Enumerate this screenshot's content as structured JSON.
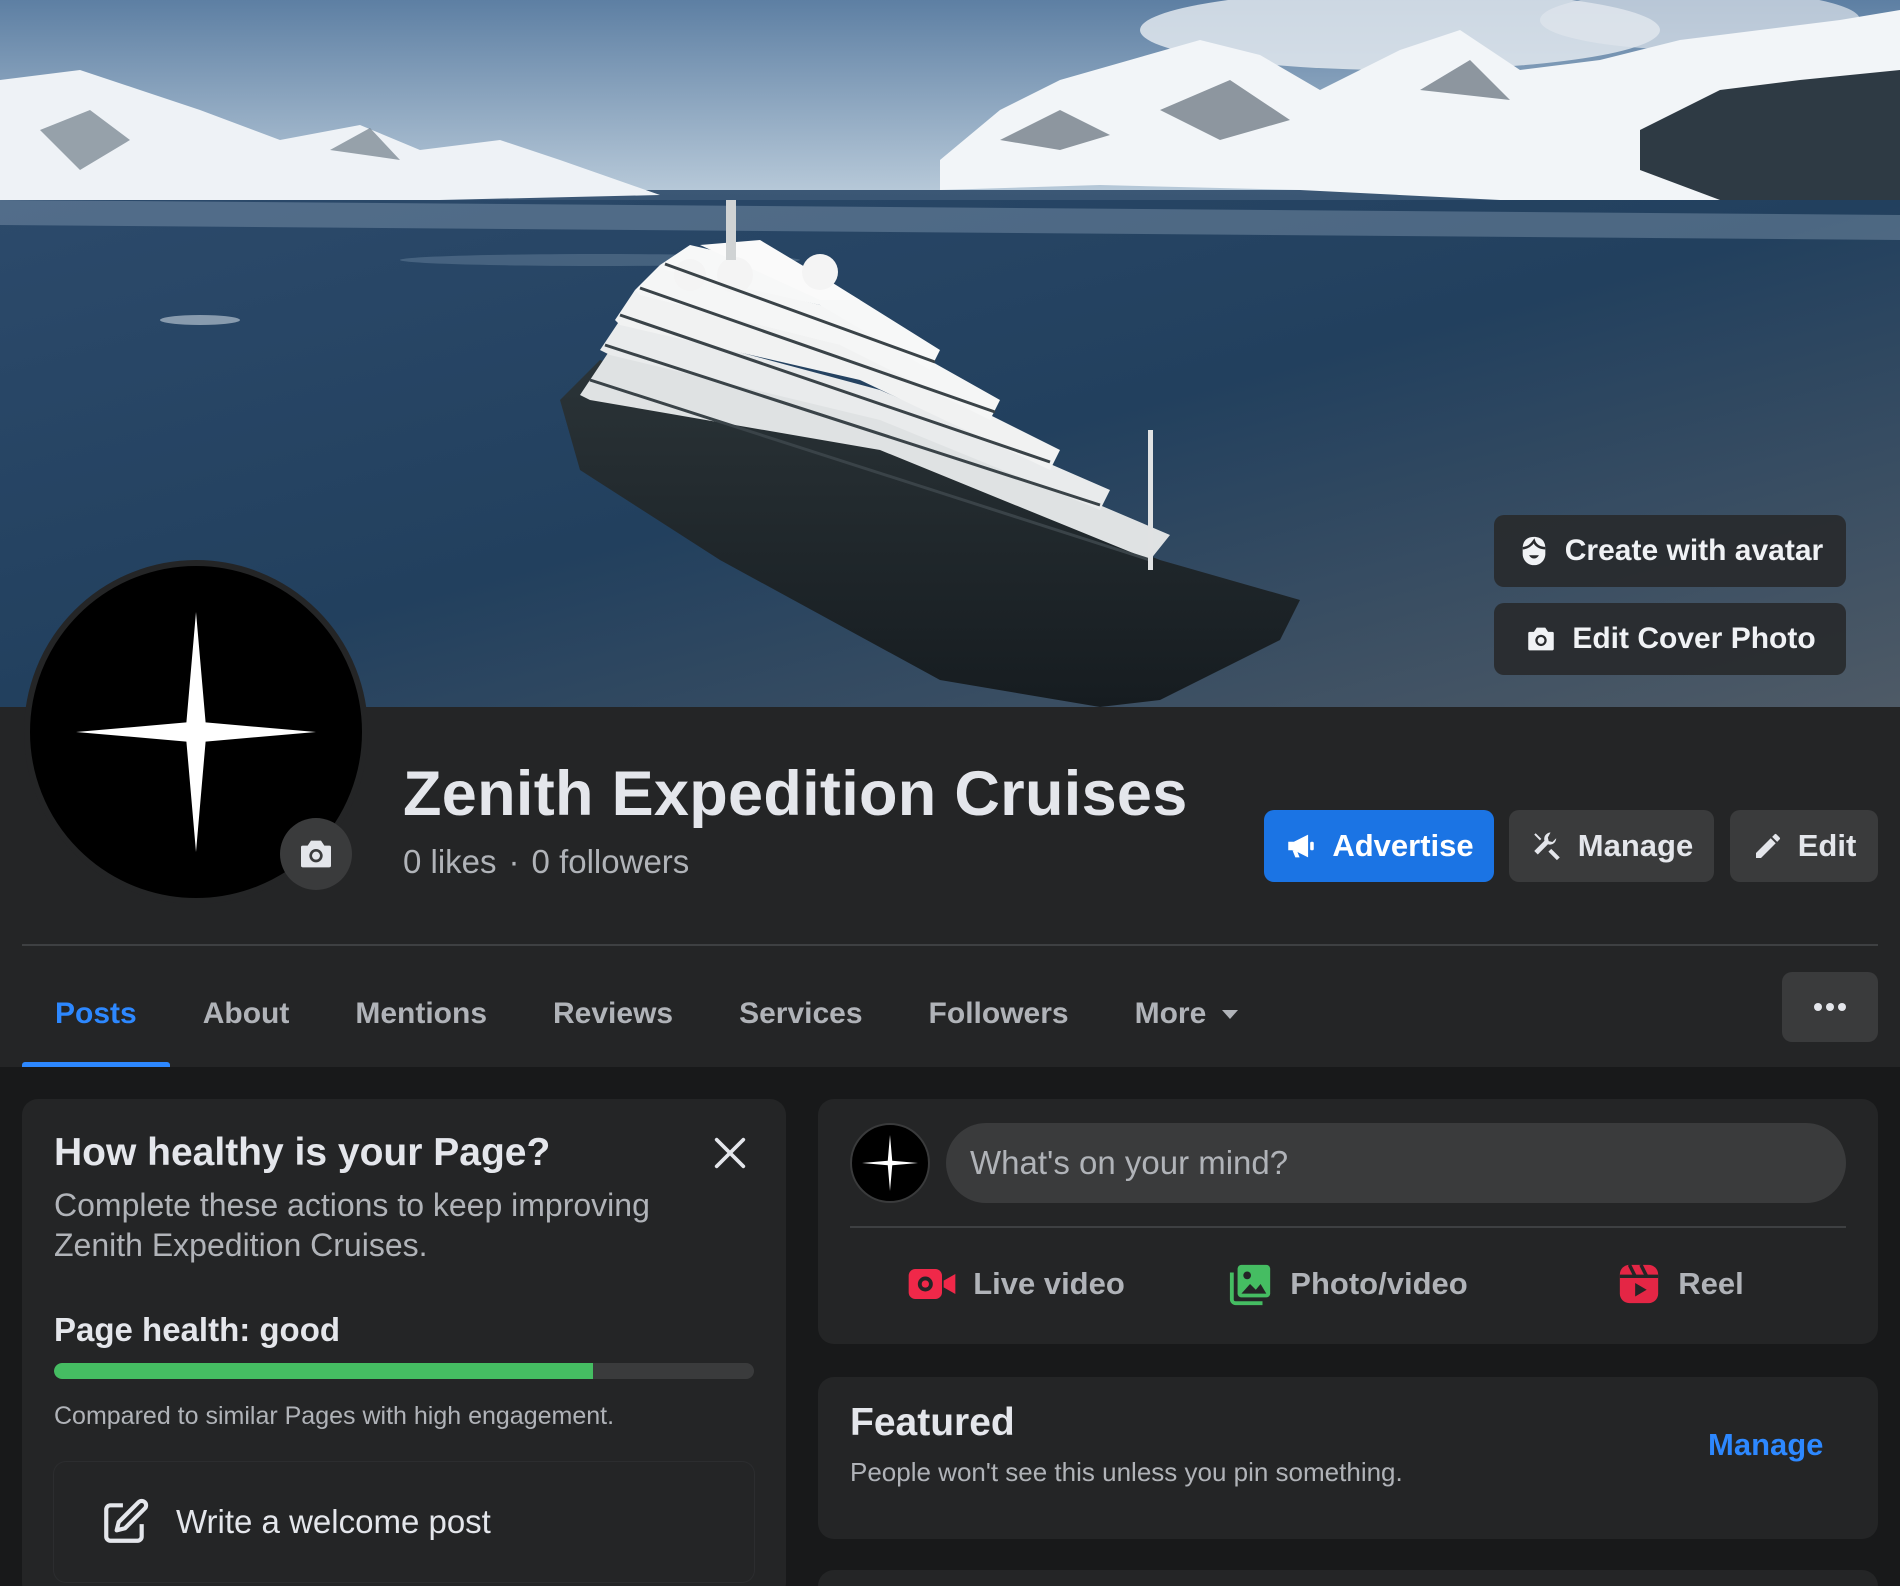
{
  "cover": {
    "create_avatar_label": "Create with avatar",
    "edit_cover_label": "Edit Cover Photo"
  },
  "page": {
    "title": "Zenith Expedition Cruises",
    "likes": "0 likes",
    "separator": "·",
    "followers": "0 followers"
  },
  "actions": {
    "advertise_label": "Advertise",
    "manage_label": "Manage",
    "edit_label": "Edit"
  },
  "tabs": [
    {
      "label": "Posts",
      "active": true
    },
    {
      "label": "About"
    },
    {
      "label": "Mentions"
    },
    {
      "label": "Reviews"
    },
    {
      "label": "Services"
    },
    {
      "label": "Followers"
    },
    {
      "label": "More"
    }
  ],
  "health": {
    "title": "How healthy is your Page?",
    "description": "Complete these actions to keep improving Zenith Expedition Cruises.",
    "status": "Page health: good",
    "progress_fraction": 0.77,
    "compare_text": "Compared to similar Pages with high engagement.",
    "welcome_label": "Write a welcome post"
  },
  "composer": {
    "placeholder": "What's on your mind?",
    "live_label": "Live video",
    "photo_label": "Photo/video",
    "reel_label": "Reel"
  },
  "featured": {
    "title": "Featured",
    "description": "People won't see this unless you pin something.",
    "manage_label": "Manage"
  },
  "colors": {
    "accent": "#1b74e4",
    "link": "#2d88ff",
    "health_good": "#45bd62",
    "live": "#f02849",
    "photo": "#45bd62",
    "reel": "#e42645"
  }
}
